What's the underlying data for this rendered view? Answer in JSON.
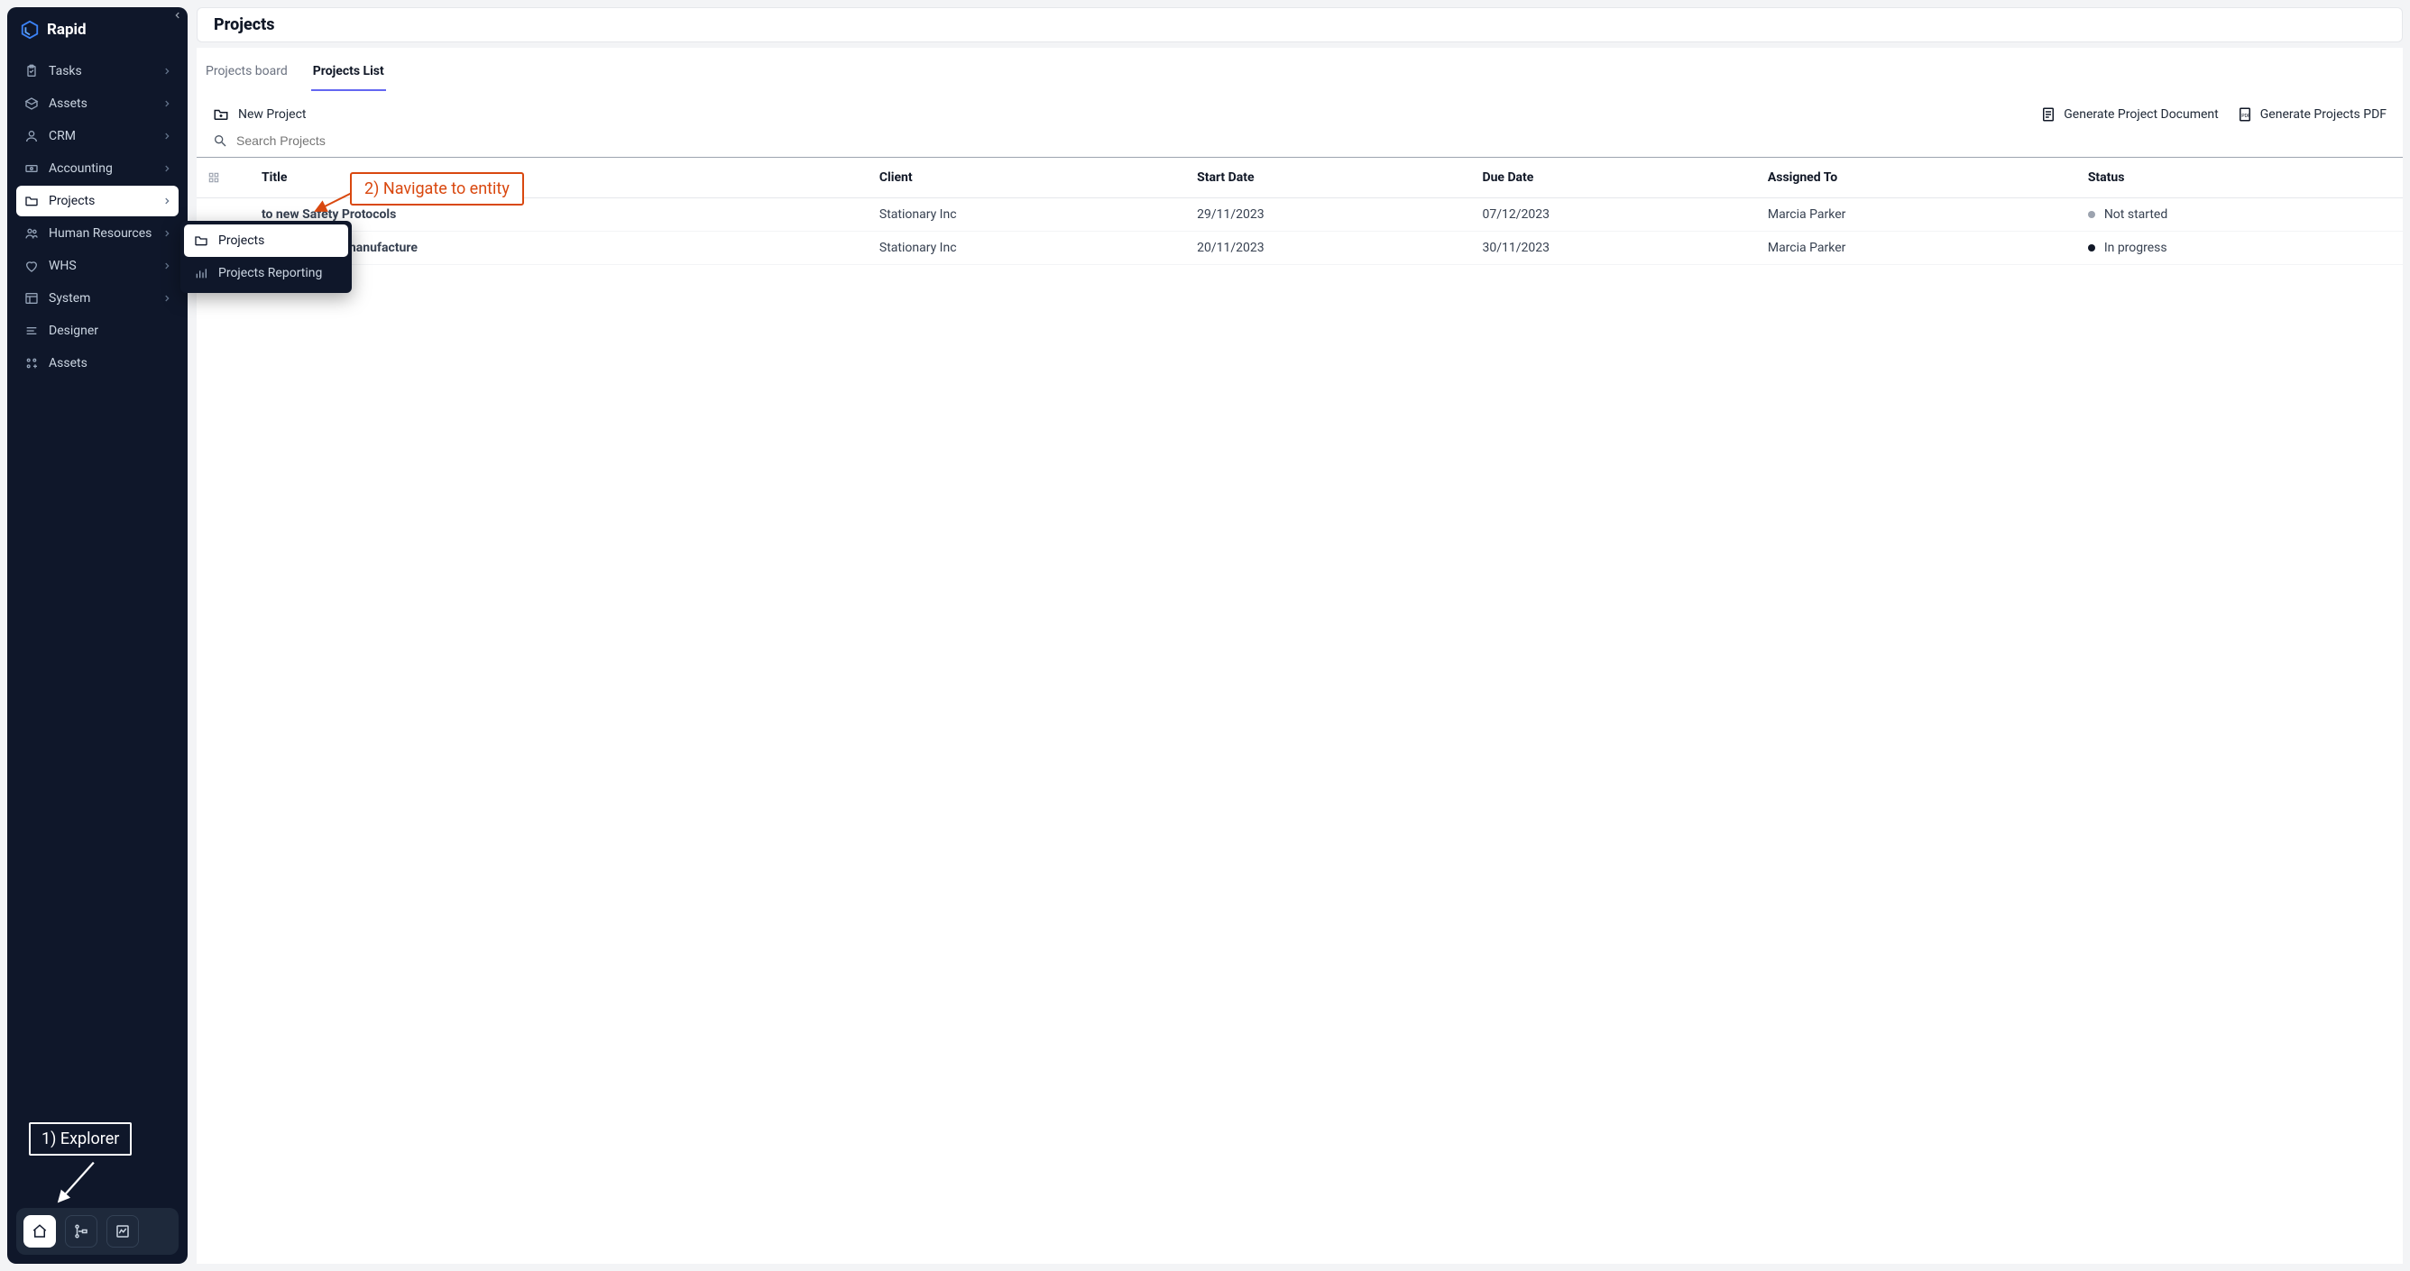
{
  "brand": "Rapid",
  "sidebar": {
    "items": [
      {
        "label": "Tasks",
        "icon": "clipboard",
        "expandable": true
      },
      {
        "label": "Assets",
        "icon": "box",
        "expandable": true
      },
      {
        "label": "CRM",
        "icon": "person",
        "expandable": true
      },
      {
        "label": "Accounting",
        "icon": "cash",
        "expandable": true
      },
      {
        "label": "Projects",
        "icon": "folder",
        "expandable": true,
        "active": true
      },
      {
        "label": "Human Resources",
        "icon": "people",
        "expandable": true
      },
      {
        "label": "WHS",
        "icon": "heart",
        "expandable": true
      },
      {
        "label": "System",
        "icon": "layout",
        "expandable": true
      },
      {
        "label": "Designer",
        "icon": "lines",
        "expandable": false
      },
      {
        "label": "Assets",
        "icon": "assets-plus",
        "expandable": false
      }
    ],
    "submenu": [
      {
        "label": "Projects",
        "icon": "folder",
        "active": true
      },
      {
        "label": "Projects Reporting",
        "icon": "bar-chart",
        "active": false
      }
    ]
  },
  "annotations": {
    "explorer": "1) Explorer",
    "navigate": "2) Navigate to entity"
  },
  "page": {
    "title": "Projects"
  },
  "tabs": [
    {
      "label": "Projects board",
      "active": false
    },
    {
      "label": "Projects List",
      "active": true
    }
  ],
  "toolbar": {
    "new_label": "New Project",
    "generate_doc": "Generate Project Document",
    "generate_pdf": "Generate Projects PDF"
  },
  "search": {
    "placeholder": "Search Projects"
  },
  "table": {
    "columns": [
      "",
      "Title",
      "Client",
      "Start Date",
      "Due Date",
      "Assigned To",
      "Status"
    ],
    "col_title": "Title",
    "col_client": "Client",
    "col_start": "Start Date",
    "col_due": "Due Date",
    "col_assigned": "Assigned To",
    "col_status": "Status",
    "rows": [
      {
        "title": "to new Safety Protocols",
        "client": "Stationary Inc",
        "start": "29/11/2023",
        "due": "07/12/2023",
        "assigned": "Marcia Parker",
        "status": "Not started",
        "status_kind": "grey"
      },
      {
        "title": "omated pencil manufacture",
        "client": "Stationary Inc",
        "start": "20/11/2023",
        "due": "30/11/2023",
        "assigned": "Marcia Parker",
        "status": "In progress",
        "status_kind": "dark"
      }
    ]
  }
}
